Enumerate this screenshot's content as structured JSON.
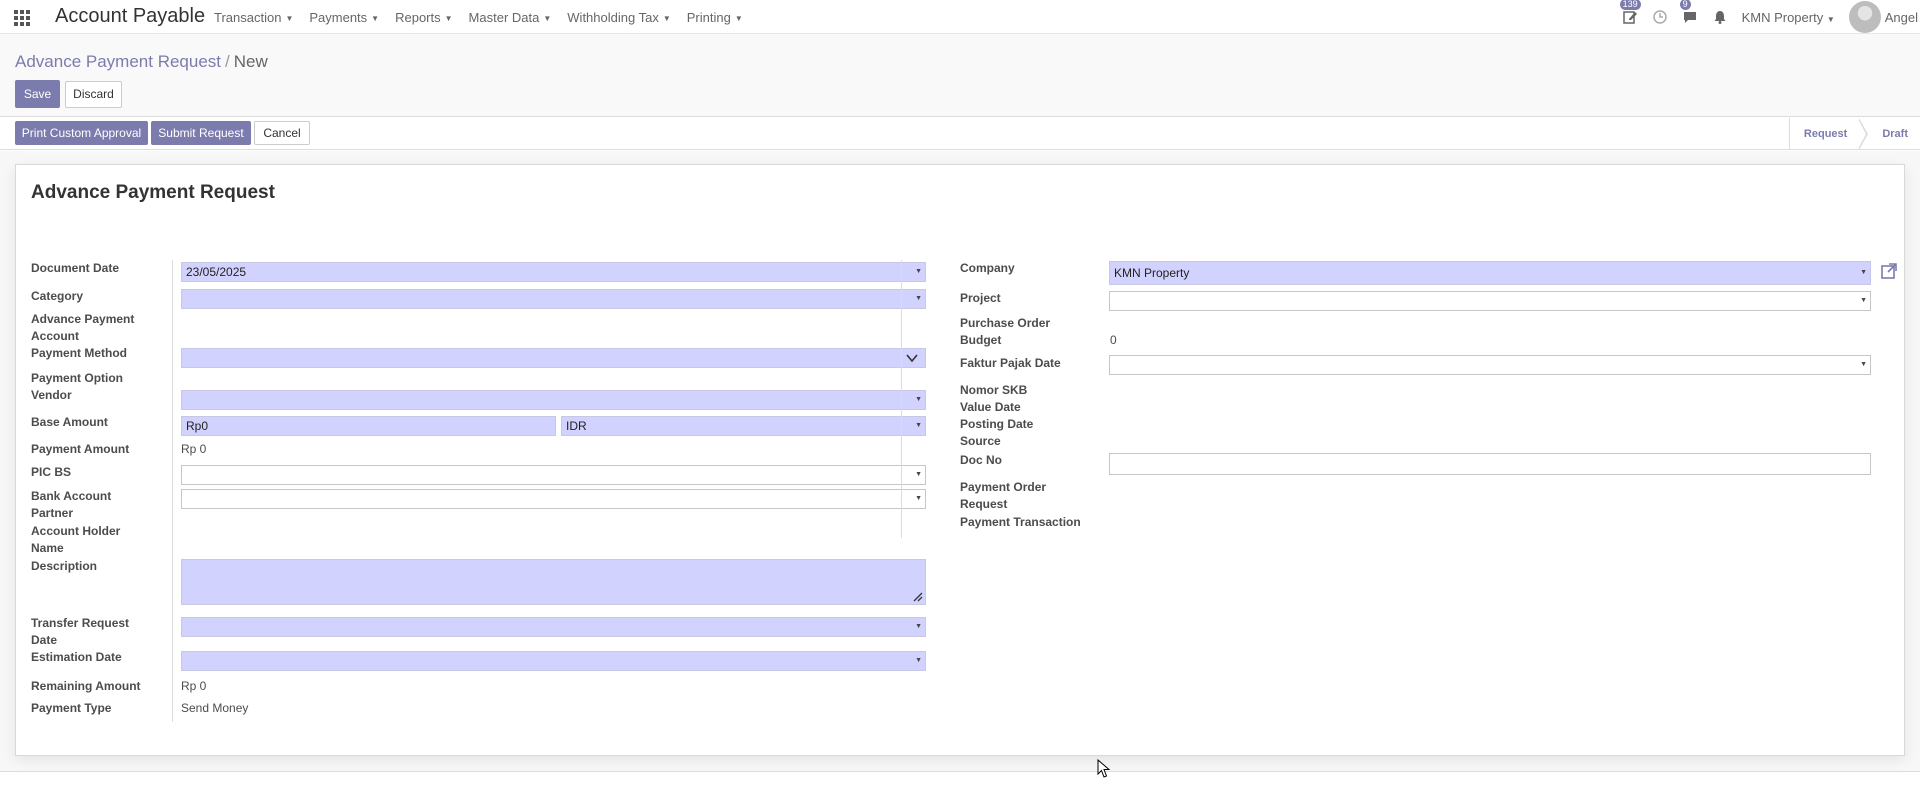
{
  "navbar": {
    "app_title": "Account Payable",
    "menu": [
      "Transaction",
      "Payments",
      "Reports",
      "Master Data",
      "Withholding Tax",
      "Printing"
    ],
    "activity_badge": "139",
    "messages_badge": "9",
    "company": "KMN Property",
    "user_name": "Angel"
  },
  "breadcrumb": {
    "parent": "Advance Payment Request",
    "separator": "/",
    "current": "New"
  },
  "control_panel": {
    "save_label": "Save",
    "discard_label": "Discard"
  },
  "statusbar": {
    "print_label": "Print Custom Approval",
    "submit_label": "Submit Request",
    "cancel_label": "Cancel",
    "stages": [
      "Request",
      "Draft"
    ]
  },
  "form": {
    "title": "Advance Payment Request",
    "left": {
      "document_date_label": "Document Date",
      "document_date_value": "23/05/2025",
      "category_label": "Category",
      "advance_payment_account_label_1": "Advance Payment",
      "advance_payment_account_label_2": "Account",
      "payment_method_label": "Payment Method",
      "payment_option_label": "Payment Option",
      "vendor_label": "Vendor",
      "base_amount_label": "Base Amount",
      "base_amount_value": "Rp0",
      "currency_value": "IDR",
      "payment_amount_label": "Payment Amount",
      "payment_amount_value": "Rp 0",
      "pic_bs_label": "PIC BS",
      "bank_account_partner_label_1": "Bank Account",
      "bank_account_partner_label_2": "Partner",
      "account_holder_name_label_1": "Account Holder",
      "account_holder_name_label_2": "Name",
      "description_label": "Description",
      "transfer_request_date_label_1": "Transfer Request",
      "transfer_request_date_label_2": "Date",
      "estimation_date_label": "Estimation Date",
      "remaining_amount_label": "Remaining Amount",
      "remaining_amount_value": "Rp 0",
      "payment_type_label": "Payment Type",
      "payment_type_value": "Send Money"
    },
    "right": {
      "company_label": "Company",
      "company_value": "KMN Property",
      "project_label": "Project",
      "po_budget_label_1": "Purchase Order",
      "po_budget_label_2": "Budget",
      "po_budget_value": "0",
      "faktur_pajak_date_label": "Faktur Pajak Date",
      "nomor_skb_label": "Nomor SKB",
      "value_date_label": "Value Date",
      "posting_date_label": "Posting Date",
      "source_label": "Source",
      "doc_no_label": "Doc No",
      "payment_order_request_label_1": "Payment Order",
      "payment_order_request_label_2": "Request",
      "payment_transaction_label": "Payment Transaction"
    }
  },
  "colors": {
    "brand": "#7c7bad",
    "required_field": "#d2d2ff"
  }
}
